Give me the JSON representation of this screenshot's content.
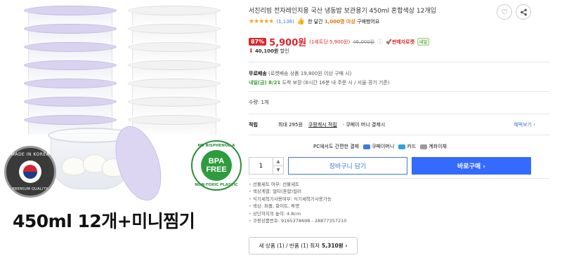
{
  "product": {
    "title": "서진리빙 전자레인지용 국산 냉동밥 보관용기 450ml 혼합색상 12개입",
    "image_caption": "450ml 12개+미니찜기",
    "badge_korea_top": "MADE IN KOREA",
    "badge_korea_bottom": "PREMIUM QUALITY",
    "badge_bpa_main_1": "BPA",
    "badge_bpa_main_2": "FREE",
    "badge_bpa_top": "NO BISPHENOL-A",
    "badge_bpa_bottom": "NON-TOXIC PLASTIC"
  },
  "rating": {
    "stars": "★★★★★",
    "review_count": "(1,136)",
    "purchase_prefix": "한 달간",
    "purchase_count": "1,000명 이상",
    "purchase_suffix": "구매했어요"
  },
  "price": {
    "discount_rate": "87%",
    "sale_price": "5,900원",
    "unit_price": "(1세트당 5,900원)",
    "original_price": "46,000원",
    "rocket_label": "판매자로켓",
    "rocket_tag": "내일"
  },
  "extra_discount": {
    "amount": "40,100원",
    "label": "할인"
  },
  "shipping": {
    "free_label": "무료배송",
    "free_condition": "(로켓배송 상품 19,800원 이상 구매 시)",
    "eta": "내일(금) 8/21",
    "eta_suffix": "도착 보장",
    "cutoff": "(8시간 16분 내 주문 시 / 서울⋅경기 기준)"
  },
  "quantity_label": "수량: 1개",
  "points": {
    "label": "적립",
    "max_prefix": "최대 295원",
    "cash_link": "쿠팡캐시 적립",
    "coupay": "· 쿠페이 머니 결제시",
    "more": "혜택보기 ›"
  },
  "payment": {
    "label": "PC에서도 간편한 결제",
    "methods": [
      "쿠페이머니",
      "카드",
      "계좌이체"
    ],
    "colors": [
      "#3d7bd6",
      "#2fa6d6",
      "#9a9a9a"
    ]
  },
  "order": {
    "qty_value": "1",
    "cart_label": "장바구니 담기",
    "buy_label": "바로구매 ›"
  },
  "specs": [
    "선물세트 여부: 선물세트",
    "색상계열: 멀티(혼합)컬러",
    "식기세척기사용여부: 식기세척기사용가능",
    "색상: 퍼플, 화이트, 투명",
    "상단까지의 높이: 4.8cm",
    "쿠팡상품번호: 9165378698 - 28877357210"
  ],
  "used": {
    "label": "새 상품 (1) / 반품 (1) 최저",
    "price": "5,310원 ›"
  },
  "icons": {
    "heart": "♡",
    "share": "share-icon"
  },
  "colors": {
    "accent_red": "#d8262c",
    "primary_blue": "#346aff",
    "link_blue": "#3d7bd6",
    "eta_green": "#3a9b3a"
  }
}
